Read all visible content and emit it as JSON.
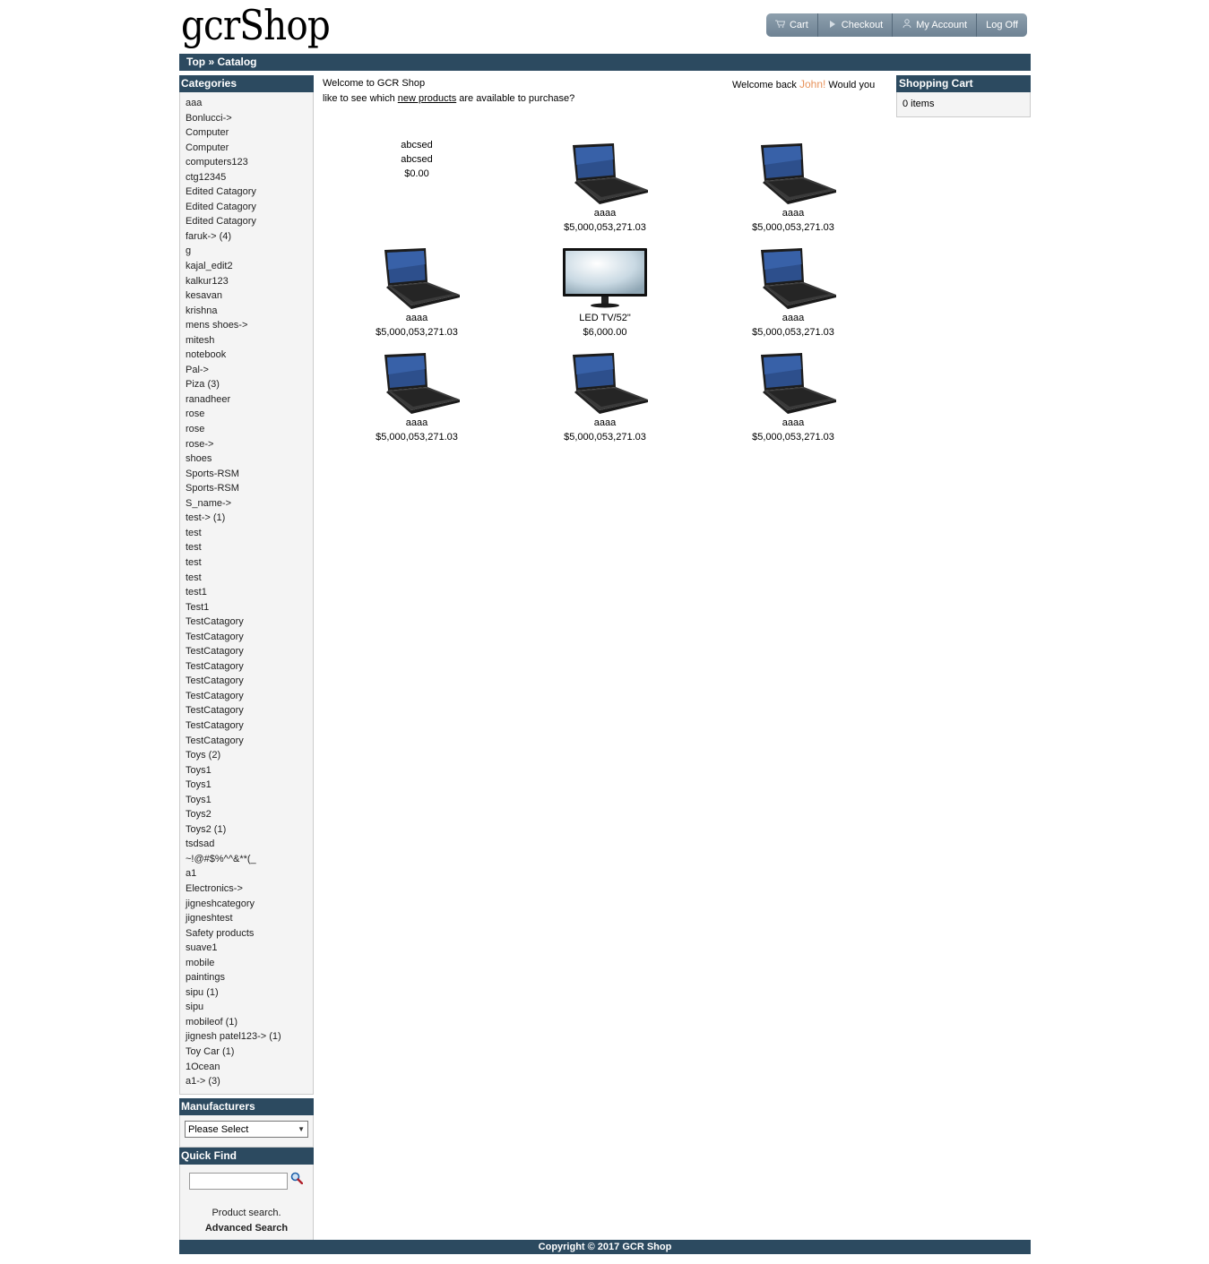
{
  "header": {
    "logo": "gcrShop",
    "nav": [
      {
        "label": "Cart",
        "icon": "cart-icon"
      },
      {
        "label": "Checkout",
        "icon": "arrow-right-icon"
      },
      {
        "label": "My Account",
        "icon": "user-icon"
      },
      {
        "label": "Log Off",
        "icon": ""
      }
    ]
  },
  "breadcrumb": {
    "top": "Top",
    "separator": "»",
    "current": "Catalog"
  },
  "categories": {
    "title": "Categories",
    "items": [
      "aaa",
      "Bonlucci->",
      "Computer",
      "Computer",
      "computers123",
      "ctg12345",
      "Edited Catagory",
      "Edited Catagory",
      "Edited Catagory",
      "faruk-> (4)",
      "g",
      "kajal_edit2",
      "kalkur123",
      "kesavan",
      "krishna",
      "mens shoes->",
      "mitesh",
      "notebook",
      "Pal->",
      "Piza (3)",
      "ranadheer",
      "rose",
      "rose",
      "rose->",
      "shoes",
      "Sports-RSM",
      "Sports-RSM",
      "S_name->",
      "test-> (1)",
      "test",
      "test",
      "test",
      "test",
      "test1",
      "Test1",
      "TestCatagory",
      "TestCatagory",
      "TestCatagory",
      "TestCatagory",
      "TestCatagory",
      "TestCatagory",
      "TestCatagory",
      "TestCatagory",
      "TestCatagory",
      "Toys (2)",
      "Toys1",
      "Toys1",
      "Toys1",
      "Toys2",
      "Toys2 (1)",
      "tsdsad",
      "~!@#$%^^&**(_",
      "a1",
      "Electronics->",
      "jigneshcategory",
      "jigneshtest",
      "Safety products",
      "suave1",
      "mobile",
      "paintings",
      "sipu (1)",
      "sipu",
      "mobileof (1)",
      "jignesh patel123-> (1)",
      "Toy Car (1)",
      "1Ocean",
      "a1-> (3)"
    ]
  },
  "manufacturers": {
    "title": "Manufacturers",
    "selected": "Please Select"
  },
  "quick_find": {
    "title": "Quick Find",
    "input_value": "",
    "help": "Product search.",
    "advanced": "Advanced Search"
  },
  "shopping_cart": {
    "title": "Shopping Cart",
    "content": "0 items"
  },
  "welcome": {
    "line1": "Welcome to GCR Shop",
    "back_prefix": "Welcome back ",
    "user": "John!",
    "back_suffix": " Would you",
    "line2_prefix": "like to see which ",
    "line2_link": "new products",
    "line2_suffix": " are available to purchase?"
  },
  "products": [
    {
      "image": "none",
      "alt": "abcsed",
      "name": "abcsed",
      "price": "$0.00"
    },
    {
      "image": "laptop",
      "name": "aaaa",
      "price": "$5,000,053,271.03"
    },
    {
      "image": "laptop",
      "name": "aaaa",
      "price": "$5,000,053,271.03"
    },
    {
      "image": "laptop",
      "name": "aaaa",
      "price": "$5,000,053,271.03"
    },
    {
      "image": "tv",
      "name": "LED TV/52\"",
      "price": "$6,000.00"
    },
    {
      "image": "laptop",
      "name": "aaaa",
      "price": "$5,000,053,271.03"
    },
    {
      "image": "laptop",
      "name": "aaaa",
      "price": "$5,000,053,271.03"
    },
    {
      "image": "laptop",
      "name": "aaaa",
      "price": "$5,000,053,271.03"
    },
    {
      "image": "laptop",
      "name": "aaaa",
      "price": "$5,000,053,271.03"
    }
  ],
  "footer": {
    "text": "Copyright © 2017 GCR Shop"
  },
  "colors": {
    "header_bar": "#2c4a60",
    "nav_button": "#7a8d9d",
    "accent_user": "#e8935c",
    "sidebar_bg": "#f4f4f4"
  }
}
